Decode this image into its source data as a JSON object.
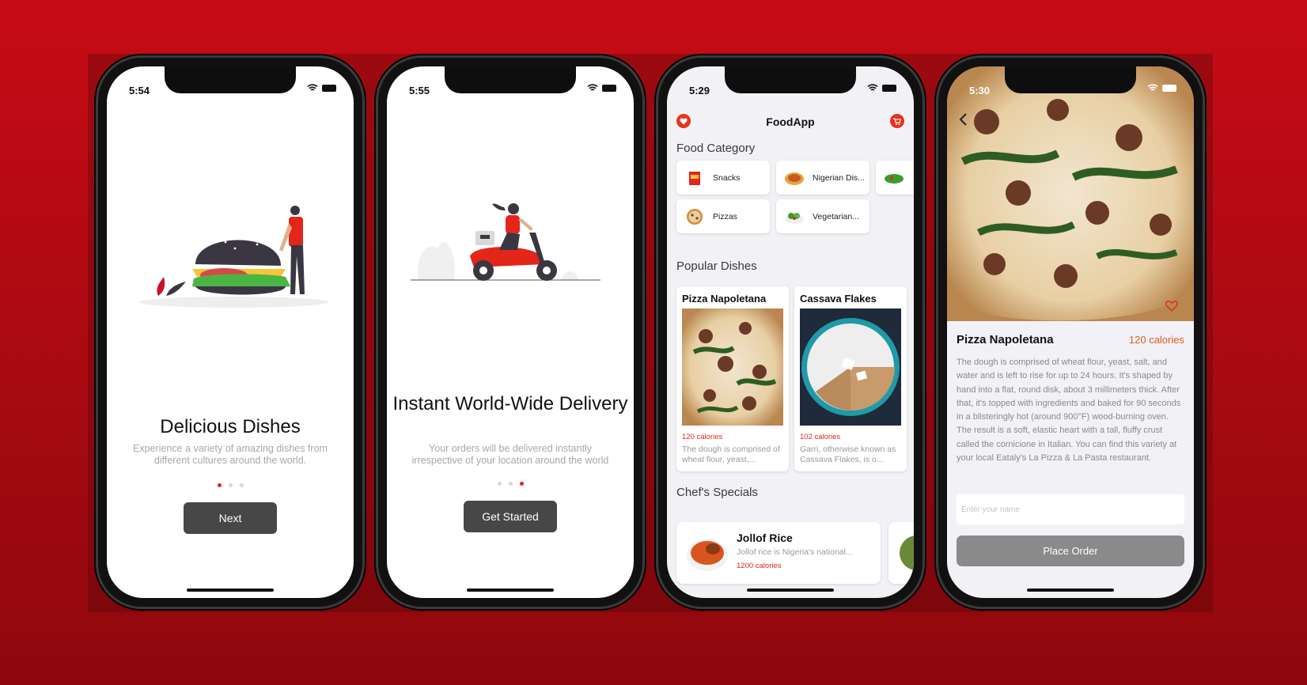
{
  "colors": {
    "background": "#b10a12",
    "accent": "#e3251a",
    "button": "#474747"
  },
  "screens": [
    {
      "time": "5:54",
      "title": "Delicious Dishes",
      "description": "Experience a variety of amazing dishes from different cultures around the world.",
      "button": "Next",
      "active_dot": 1,
      "illustration": "burger-illustration"
    },
    {
      "time": "5:55",
      "title": "Instant World-Wide Delivery",
      "description": "Your orders will be delivered instantly irrespective of your location around the world",
      "button": "Get Started",
      "active_dot": 3,
      "illustration": "scooter-delivery-illustration"
    },
    {
      "time": "5:29",
      "app_title": "FoodApp",
      "sections": {
        "category": "Food Category",
        "popular": "Popular Dishes",
        "specials": "Chef's Specials"
      },
      "categories": [
        "Snacks",
        "Nigerian Dis...",
        "Pizzas",
        "Vegetarian..."
      ],
      "popular": [
        {
          "name": "Pizza Napoletana",
          "calories": "120 calories",
          "description": "The dough is comprised of wheat flour, yeast,..."
        },
        {
          "name": "Cassava Flakes",
          "calories": "102 calories",
          "description": "Garri, otherwise known as Cassava Flakes, is o..."
        }
      ],
      "specials": [
        {
          "name": "Jollof Rice",
          "description": "Jollof rice is Nigeria's national...",
          "calories": "1200 calories"
        }
      ]
    },
    {
      "time": "5:30",
      "name": "Pizza Napoletana",
      "calories": "120 calories",
      "description": "The dough is comprised of wheat flour, yeast, salt, and water and is left to rise for up to 24 hours. It's shaped by hand into a flat, round disk, about 3 millimeters thick. After that, it's topped with ingredients and baked for 90 seconds in a blisteringly hot (around 900°F) wood-burning oven. The result is a soft, elastic heart with a tall, fluffy crust called the cornicione in Italian. You can find this variety at your local Eataly's La Pizza & La Pasta restaurant.",
      "input_placeholder": "Enter your name",
      "button": "Place Order"
    }
  ]
}
